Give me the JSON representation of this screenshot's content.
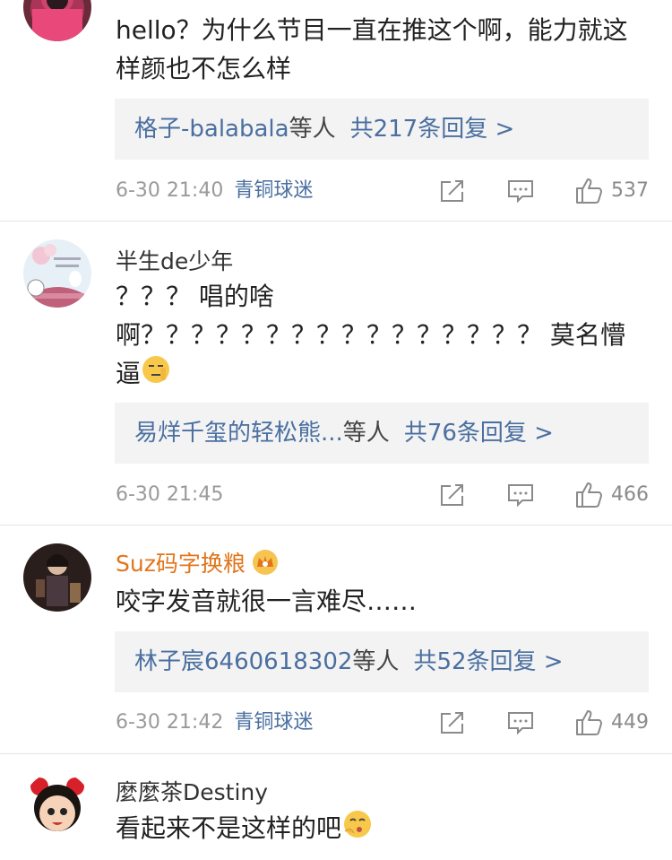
{
  "comments": [
    {
      "username": "",
      "text": "hello？为什么节目一直在推这个啊，能力就这样颜也不怎么样",
      "reply_names": "格子-balabala",
      "reply_etc": "等人",
      "reply_count": "共217条回复 >",
      "time": "6-30 21:40",
      "badge": "青铜球迷",
      "likes": "537"
    },
    {
      "username": "半生de少年",
      "text_line1": "？？？ 唱的啥",
      "text_line2": "啊？？？？？？？？？？？？？？？？ 莫名懵",
      "text_line3": "逼",
      "reply_names": "易烊千玺的轻松熊...",
      "reply_etc": "等人",
      "reply_count": "共76条回复 >",
      "time": "6-30 21:45",
      "badge": "",
      "likes": "466"
    },
    {
      "username": "Suz码字换粮",
      "text": "咬字发音就很一言难尽……",
      "reply_names": "林子宸6460618302",
      "reply_etc": "等人",
      "reply_count": "共52条回复 >",
      "time": "6-30 21:42",
      "badge": "青铜球迷",
      "likes": "449"
    },
    {
      "username": "麼麼茶Destiny",
      "text": "看起来不是这样的吧"
    }
  ],
  "icons": {
    "share": "share-icon",
    "comment": "comment-icon",
    "like": "thumbs-up-icon",
    "crown": "crown-icon"
  },
  "colors": {
    "link": "#4a6fa0",
    "vip_name": "#e2751c",
    "meta": "#9a9a9a",
    "reply_bg": "#f3f3f3"
  }
}
